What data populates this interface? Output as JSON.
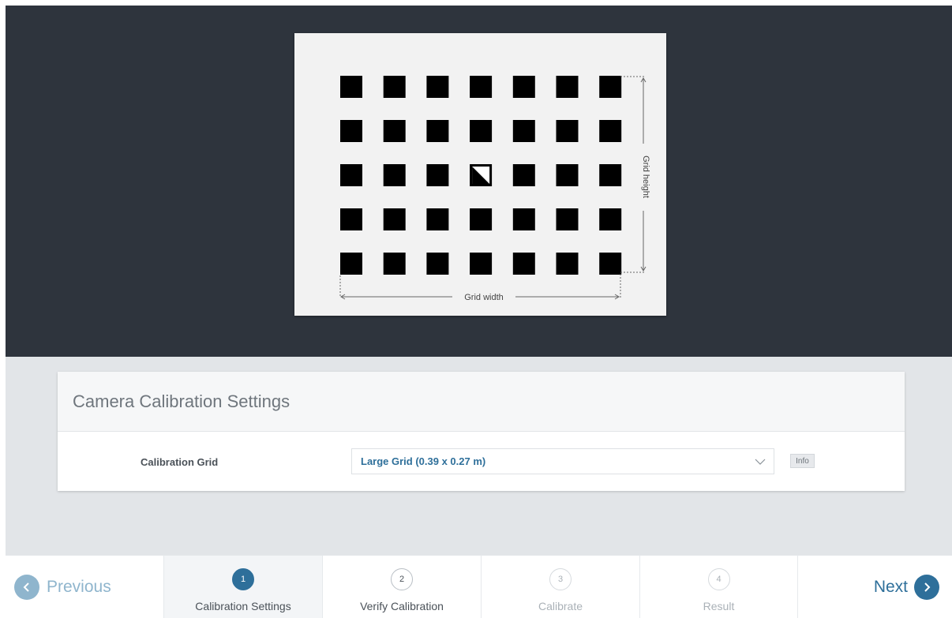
{
  "preview": {
    "grid_width_label": "Grid width",
    "grid_height_label": "Grid height",
    "grid_columns": 7,
    "grid_rows": 5
  },
  "panel": {
    "title": "Camera Calibration Settings",
    "calibration_grid_label": "Calibration Grid",
    "calibration_grid_value": "Large Grid (0.39 x 0.27 m)",
    "info_label": "Info"
  },
  "footer": {
    "previous_label": "Previous",
    "next_label": "Next",
    "steps": [
      {
        "number": "1",
        "label": "Calibration Settings",
        "state": "active"
      },
      {
        "number": "2",
        "label": "Verify Calibration",
        "state": "next"
      },
      {
        "number": "3",
        "label": "Calibrate",
        "state": "disabled"
      },
      {
        "number": "4",
        "label": "Result",
        "state": "disabled"
      }
    ]
  },
  "colors": {
    "preview_background": "#2e343d",
    "accent": "#2e6f9a",
    "accent_light": "#8fb5cd",
    "settings_background": "#e2e5e8"
  }
}
